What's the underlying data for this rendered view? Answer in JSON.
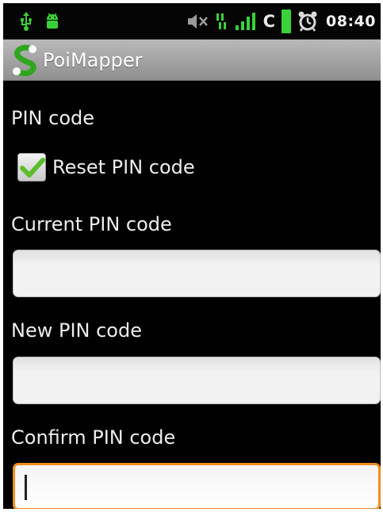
{
  "status_bar": {
    "network_type": "C",
    "time": "08:40",
    "icons": [
      "usb-icon",
      "android-debug-icon",
      "mute-icon",
      "data-transfer-icon",
      "signal-icon",
      "battery-icon",
      "alarm-icon"
    ]
  },
  "title_bar": {
    "app_name": "PoiMapper",
    "icon": "app-logo-icon"
  },
  "form": {
    "section_label": "PIN code",
    "reset_checkbox": {
      "label": "Reset PIN code",
      "checked": true
    },
    "current_pin": {
      "label": "Current PIN code",
      "value": ""
    },
    "new_pin": {
      "label": "New PIN code",
      "value": ""
    },
    "confirm_pin": {
      "label": "Confirm PIN code",
      "value": ""
    }
  },
  "colors": {
    "status_bar_bg": "#050505",
    "title_bar_bg": "#a6a6a6",
    "content_bg": "#000000",
    "focus_accent": "#f08d1c",
    "battery_green": "#3ad13a",
    "checkmark_green": "#5bbd2b"
  }
}
